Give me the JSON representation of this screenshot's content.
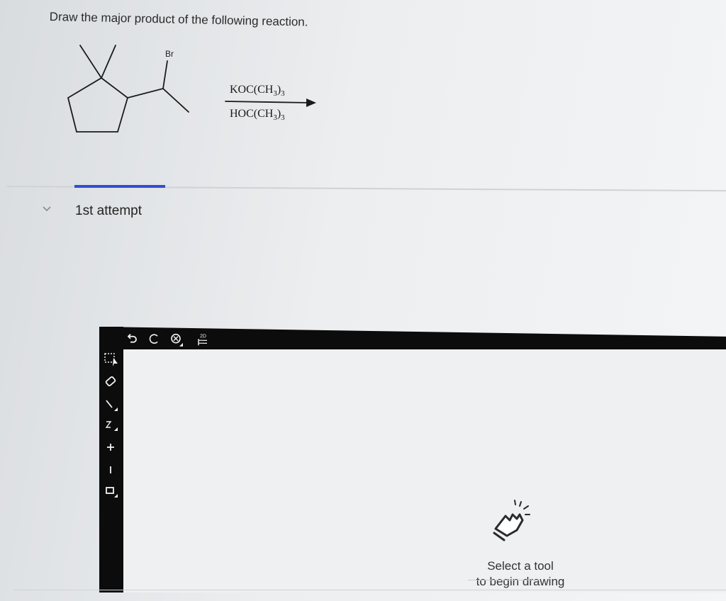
{
  "question": {
    "prompt": "Draw the major product of the following reaction."
  },
  "reaction": {
    "substituent_label": "Br",
    "reagent_top": {
      "main": "KOC(CH",
      "sub1": "3",
      "close": ")",
      "sub2": "3"
    },
    "reagent_bottom": {
      "main": "HOC(CH",
      "sub1": "3",
      "close": ")",
      "sub2": "3"
    }
  },
  "attempt": {
    "label": "1st attempt",
    "indicator_color": "#2f4fd3"
  },
  "editor": {
    "top_tools": [
      "select-ring-icon",
      "undo-icon",
      "redo-icon",
      "zoom-icon",
      "2d-template-icon"
    ],
    "template_badge": "2D",
    "left_tools": [
      "marquee-select-icon",
      "eraser-icon",
      "single-bond-icon",
      "chain-icon",
      "charge-plus-icon",
      "charge-minus-icon",
      "ring-shape-icon"
    ],
    "hint_line1": "Select a tool",
    "hint_line2": "to begin drawing"
  }
}
